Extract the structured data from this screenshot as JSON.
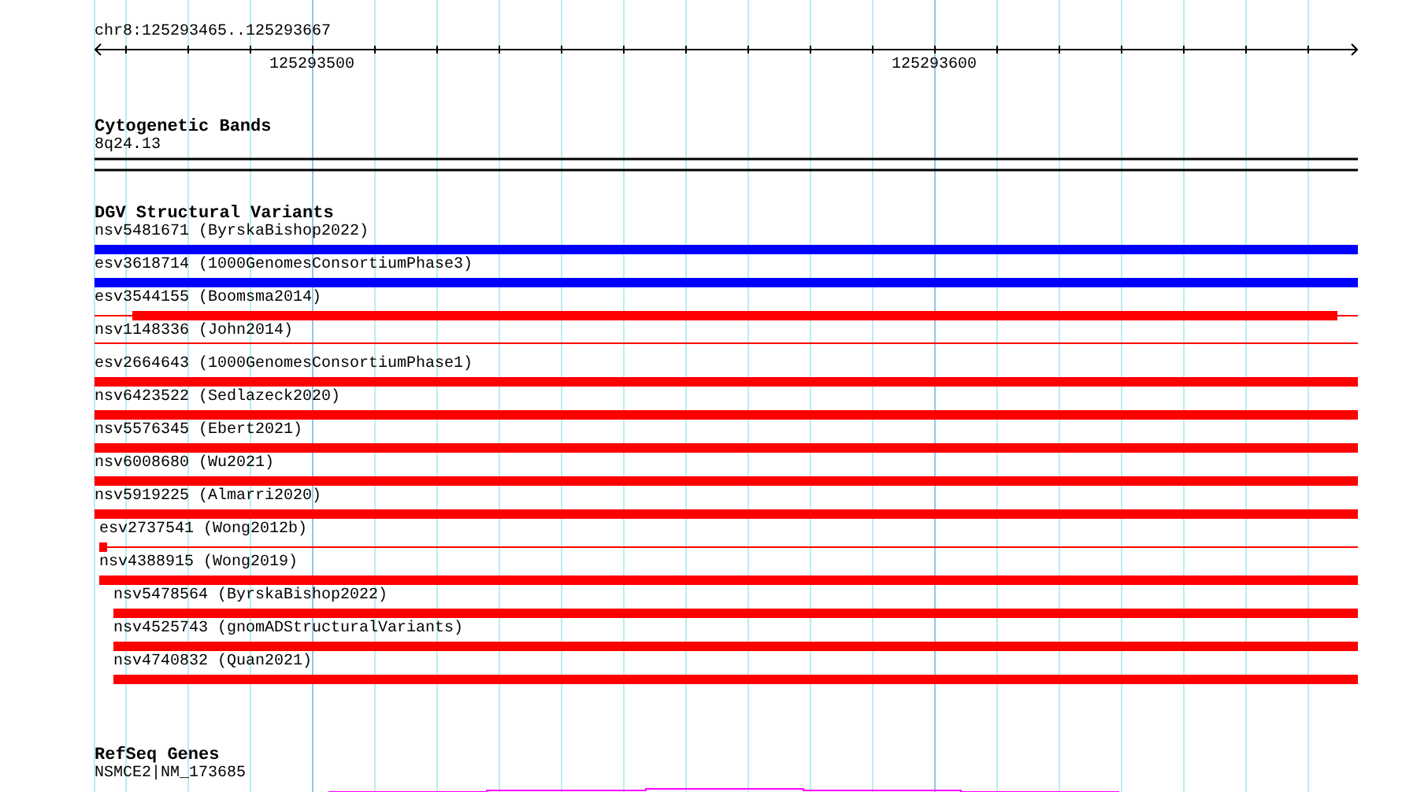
{
  "ruler": {
    "range": "chr8:125293465..125293667",
    "tick_labels": [
      "125293500",
      "125293600"
    ]
  },
  "cytogenetic_bands": {
    "title": "Cytogenetic Bands",
    "band": "8q24.13"
  },
  "structural_variants": {
    "title": "DGV Structural Variants",
    "items": [
      {
        "label": "nsv5481671 (ByrskaBishop2022)",
        "color": "#0000ff",
        "kind": "bar"
      },
      {
        "label": "esv3618714 (1000GenomesConsortiumPhase3)",
        "color": "#0000ff",
        "kind": "bar"
      },
      {
        "label": "esv3544155 (Boomsma2014)",
        "color": "#ff0000",
        "kind": "partial"
      },
      {
        "label": "nsv1148336 (John2014)",
        "color": "#ff0000",
        "kind": "line"
      },
      {
        "label": "esv2664643 (1000GenomesConsortiumPhase1)",
        "color": "#ff0000",
        "kind": "bar"
      },
      {
        "label": "nsv6423522 (Sedlazeck2020)",
        "color": "#ff0000",
        "kind": "bar"
      },
      {
        "label": "nsv5576345 (Ebert2021)",
        "color": "#ff0000",
        "kind": "bar"
      },
      {
        "label": "nsv6008680 (Wu2021)",
        "color": "#ff0000",
        "kind": "bar"
      },
      {
        "label": "nsv5919225 (Almarri2020)",
        "color": "#ff0000",
        "kind": "bar"
      },
      {
        "label": "esv2737541 (Wong2012b)",
        "color": "#ff0000",
        "kind": "partial"
      },
      {
        "label": "nsv4388915 (Wong2019)",
        "color": "#ff0000",
        "kind": "bar"
      },
      {
        "label": "nsv5478564 (ByrskaBishop2022)",
        "color": "#ff0000",
        "kind": "bar"
      },
      {
        "label": "nsv4525743 (gnomADStructuralVariants)",
        "color": "#ff0000",
        "kind": "bar"
      },
      {
        "label": "nsv4740832 (Quan2021)",
        "color": "#ff0000",
        "kind": "bar"
      }
    ]
  },
  "refseq_genes": {
    "title": "RefSeq Genes",
    "gene": "NSMCE2|NM_173685"
  }
}
